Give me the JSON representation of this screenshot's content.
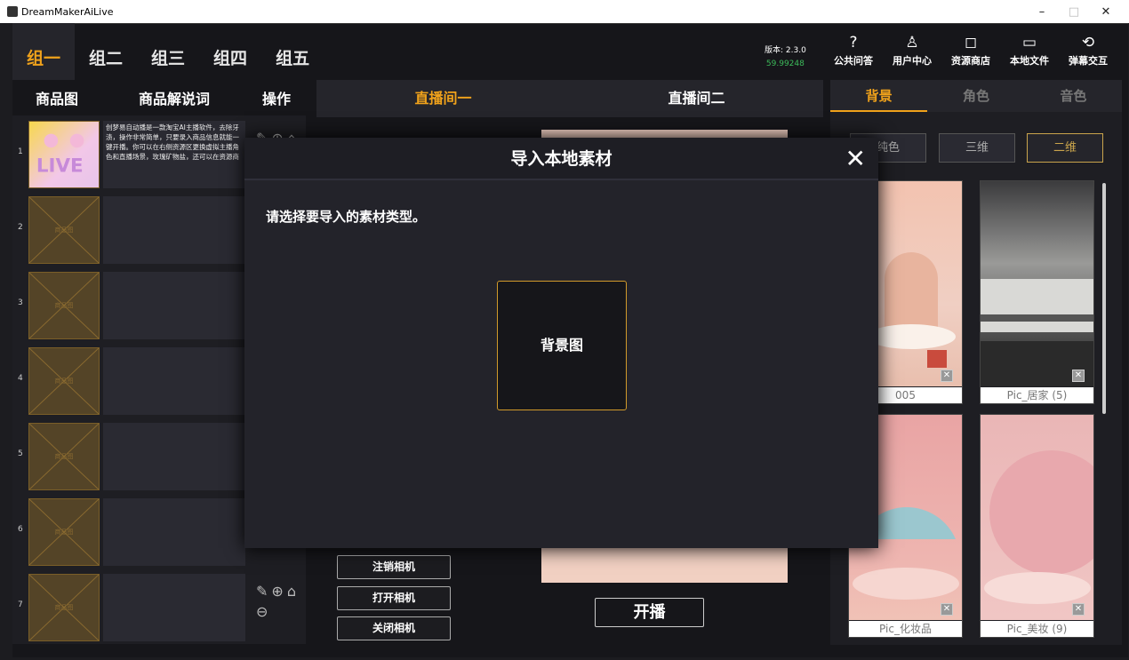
{
  "window": {
    "title": "DreamMakerAiLive",
    "controls": [
      "–",
      "□",
      "✕"
    ]
  },
  "groups": [
    "组一",
    "组二",
    "组三",
    "组四",
    "组五"
  ],
  "version": {
    "label": "版本: 2.3.0",
    "value": "59.99248"
  },
  "top_icons": [
    {
      "icon": "?",
      "label": "公共问答",
      "name": "help-icon"
    },
    {
      "icon": "♙",
      "label": "用户中心",
      "name": "user-icon"
    },
    {
      "icon": "◻",
      "label": "资源商店",
      "name": "shop-icon"
    },
    {
      "icon": "▭",
      "label": "本地文件",
      "name": "folder-icon"
    },
    {
      "icon": "⟲",
      "label": "弹幕交互",
      "name": "interact-icon"
    }
  ],
  "left": {
    "headers": [
      "商品图",
      "商品解说词",
      "操作"
    ],
    "rows": [
      {
        "num": "1",
        "desc": "创梦易自动播是一款淘宝AI主播软件，去除牙渍，操作非常简单，只要录入商品信息就能一键开播。你可以在右侧资源区更换虚拟主播角色和直播场景，玫瑰矿物盐，还可以在资源商"
      },
      {
        "num": "2",
        "desc": ""
      },
      {
        "num": "3",
        "desc": ""
      },
      {
        "num": "4",
        "desc": ""
      },
      {
        "num": "5",
        "desc": ""
      },
      {
        "num": "6",
        "desc": ""
      },
      {
        "num": "7",
        "desc": ""
      }
    ],
    "thumb_placeholder": "商品图"
  },
  "center": {
    "tabs": [
      "直播间一",
      "直播间二"
    ],
    "camera_buttons": [
      "注销相机",
      "打开相机",
      "关闭相机"
    ],
    "start_button": "开播"
  },
  "right": {
    "tabs": [
      "背景",
      "角色",
      "音色"
    ],
    "types": [
      "纯色",
      "三维",
      "二维"
    ],
    "cards": [
      {
        "caption": "005"
      },
      {
        "caption": "Pic_居家 (5)"
      },
      {
        "caption": "Pic_化妆品"
      },
      {
        "caption": "Pic_美妆 (9)"
      }
    ]
  },
  "dialog": {
    "title": "导入本地素材",
    "prompt": "请选择要导入的素材类型。",
    "option": "背景图",
    "close": "✕"
  },
  "colors": {
    "accent": "#f0a21b"
  }
}
